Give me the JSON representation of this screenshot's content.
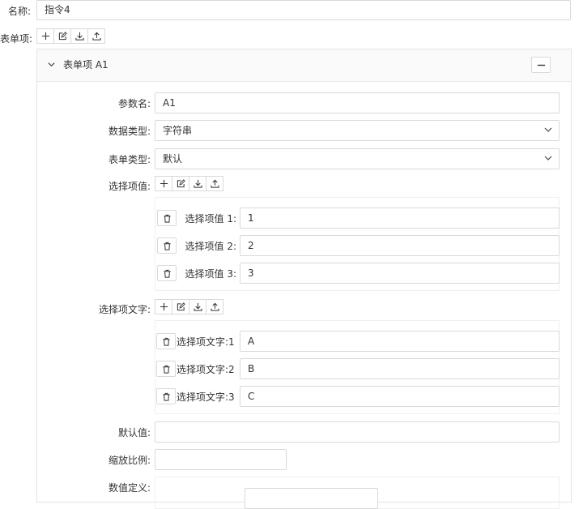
{
  "name": {
    "label": "名称:",
    "value": "指令4"
  },
  "form_items": {
    "label": "表单项:",
    "toolbar": [
      "add-icon",
      "edit-icon",
      "download-icon",
      "upload-icon"
    ]
  },
  "item": {
    "title": "表单项 A1",
    "collapse_icon": "chevron-down-icon",
    "remove_icon": "minus-icon",
    "param_name": {
      "label": "参数名:",
      "value": "A1"
    },
    "data_type": {
      "label": "数据类型:",
      "value": "字符串"
    },
    "form_type": {
      "label": "表单类型:",
      "value": "默认"
    },
    "option_values": {
      "label": "选择项值:",
      "rows": [
        {
          "label": "选择项值 1:",
          "value": "1"
        },
        {
          "label": "选择项值 2:",
          "value": "2"
        },
        {
          "label": "选择项值 3:",
          "value": "3"
        }
      ]
    },
    "option_texts": {
      "label": "选择项文字:",
      "rows": [
        {
          "label": "选择项文字:1",
          "value": "A"
        },
        {
          "label": "选择项文字:2",
          "value": "B"
        },
        {
          "label": "选择项文字:3",
          "value": "C"
        }
      ]
    },
    "default_value": {
      "label": "默认值:",
      "value": ""
    },
    "scale": {
      "label": "缩放比例:",
      "value": ""
    },
    "numeric_def": {
      "label": "数值定义:"
    }
  },
  "colors": {
    "panel_header_bg": "#fafafa",
    "border": "#d9d9d9"
  }
}
